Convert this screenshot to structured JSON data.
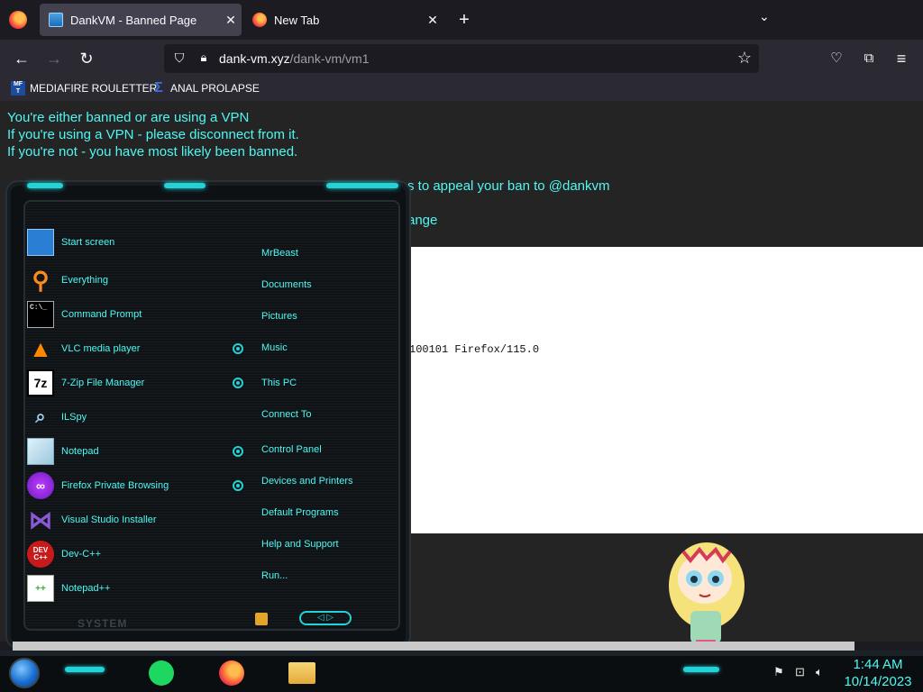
{
  "browser": {
    "tabs": [
      {
        "title": "DankVM - Banned Page",
        "active": true
      },
      {
        "title": "New Tab",
        "active": false
      }
    ],
    "url": {
      "host": "dank-vm.xyz",
      "path": "/dank-vm/vm1"
    },
    "bookmarks": [
      {
        "label": "MEDIAFIRE ROULETTER",
        "icon": "mediafire-icon"
      },
      {
        "label": "ANAL PROLAPSE",
        "icon": "sigma-icon"
      }
    ]
  },
  "page": {
    "lines": [
      "You're either banned or are using a VPN",
      "If you're using a VPN - please disconnect from it.",
      "If you're not - you have most likely been banned.",
      "s to appeal your ban to @dankvm",
      "ange"
    ],
    "ua_fragment": "100101 Firefox/115.0"
  },
  "start_menu": {
    "programs": [
      {
        "label": "Start screen",
        "icon": "start-screen-icon",
        "has_submenu": false
      },
      {
        "label": "Everything",
        "icon": "magnifier-icon",
        "has_submenu": false
      },
      {
        "label": "Command Prompt",
        "icon": "cmd-icon",
        "has_submenu": false
      },
      {
        "label": "VLC media player",
        "icon": "vlc-cone-icon",
        "has_submenu": true
      },
      {
        "label": "7-Zip File Manager",
        "icon": "7zip-icon",
        "has_submenu": true
      },
      {
        "label": "ILSpy",
        "icon": "ilspy-icon",
        "has_submenu": false
      },
      {
        "label": "Notepad",
        "icon": "notepad-icon",
        "has_submenu": true
      },
      {
        "label": "Firefox Private Browsing",
        "icon": "firefox-private-icon",
        "has_submenu": true
      },
      {
        "label": "Visual Studio Installer",
        "icon": "visual-studio-icon",
        "has_submenu": false
      },
      {
        "label": "Dev-C++",
        "icon": "devcpp-icon",
        "has_submenu": false
      },
      {
        "label": "Notepad++",
        "icon": "notepadpp-icon",
        "has_submenu": false
      }
    ],
    "places": [
      "MrBeast",
      "Documents",
      "Pictures",
      "Music",
      "This PC",
      "Connect To",
      "Control Panel",
      "Devices and Printers",
      "Default Programs",
      "Help and Support",
      "Run..."
    ],
    "system_label": "SYSTEM"
  },
  "taskbar": {
    "time": "1:44 AM",
    "date": "10/14/2023",
    "apps": [
      "spotify-icon",
      "firefox-icon",
      "file-explorer-icon"
    ]
  },
  "colors": {
    "accent": "#4ff7f2",
    "glow": "#24d1d6"
  }
}
